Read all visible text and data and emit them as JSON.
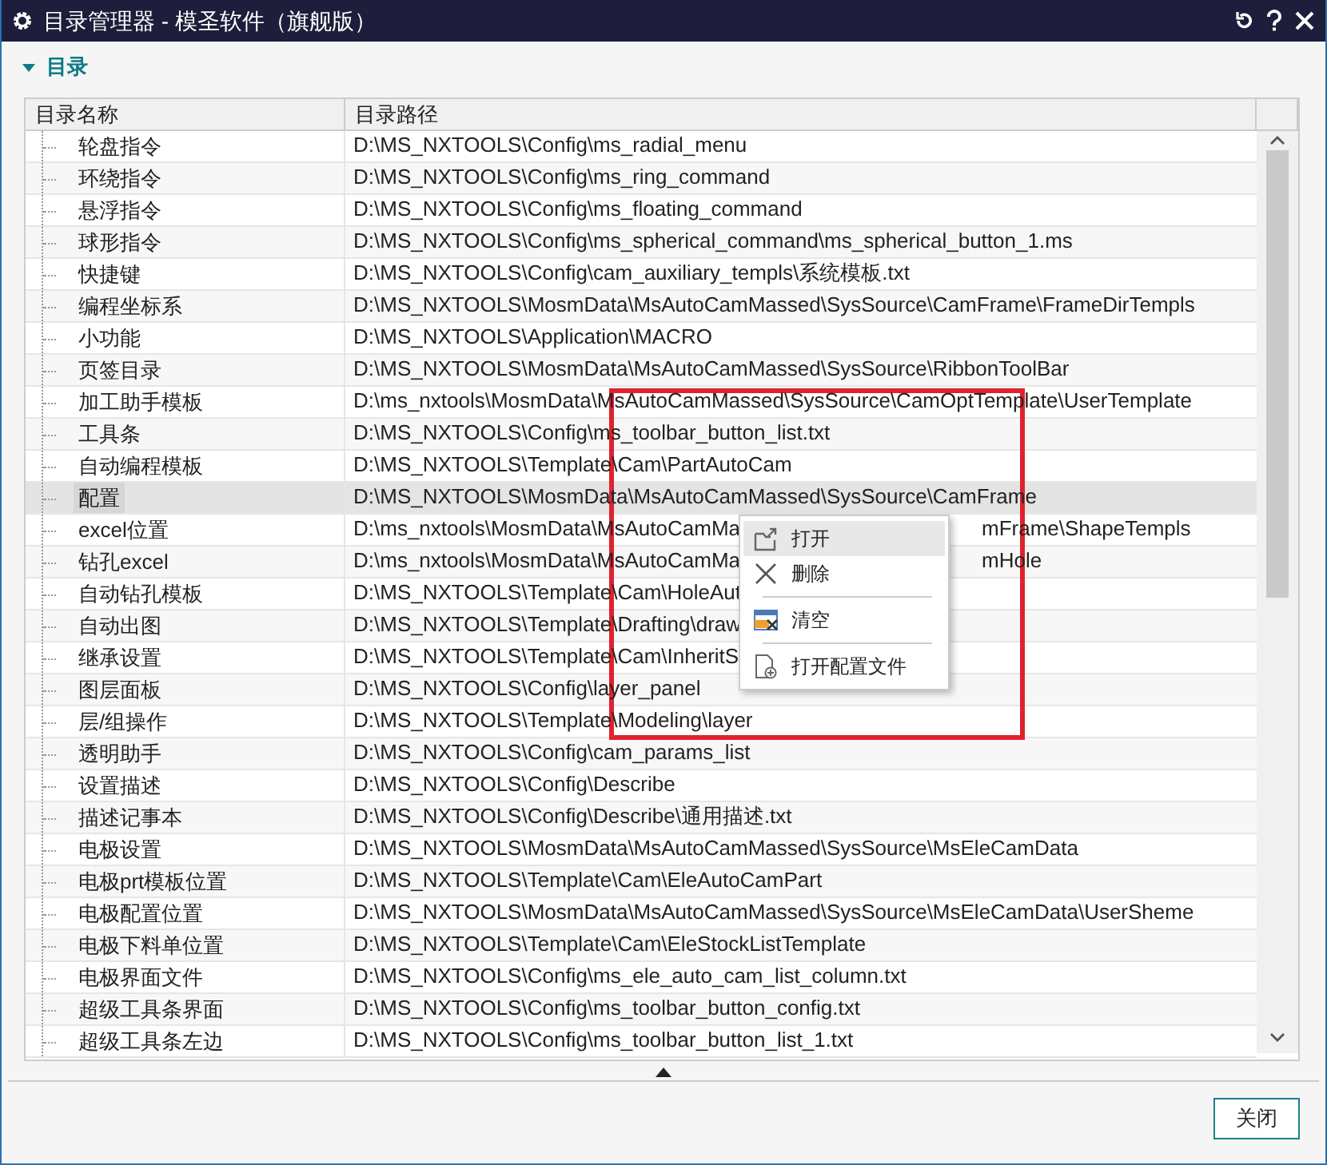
{
  "window": {
    "title": "目录管理器 - 模圣软件（旗舰版）"
  },
  "section": {
    "label": "目录",
    "expanded": true
  },
  "table": {
    "columns": [
      "目录名称",
      "目录路径"
    ],
    "rows": [
      {
        "name": "轮盘指令",
        "path": "D:\\MS_NXTOOLS\\Config\\ms_radial_menu",
        "selected": false
      },
      {
        "name": "环绕指令",
        "path": "D:\\MS_NXTOOLS\\Config\\ms_ring_command",
        "selected": false
      },
      {
        "name": "悬浮指令",
        "path": "D:\\MS_NXTOOLS\\Config\\ms_floating_command",
        "selected": false
      },
      {
        "name": "球形指令",
        "path": "D:\\MS_NXTOOLS\\Config\\ms_spherical_command\\ms_spherical_button_1.ms",
        "selected": false
      },
      {
        "name": "快捷键",
        "path": "D:\\MS_NXTOOLS\\Config\\cam_auxiliary_templs\\系统模板.txt",
        "selected": false
      },
      {
        "name": "编程坐标系",
        "path": "D:\\MS_NXTOOLS\\MosmData\\MsAutoCamMassed\\SysSource\\CamFrame\\FrameDirTempls",
        "selected": false
      },
      {
        "name": "小功能",
        "path": "D:\\MS_NXTOOLS\\Application\\MACRO",
        "selected": false
      },
      {
        "name": "页签目录",
        "path": "D:\\MS_NXTOOLS\\MosmData\\MsAutoCamMassed\\SysSource\\RibbonToolBar",
        "selected": false
      },
      {
        "name": "加工助手模板",
        "path": "D:\\ms_nxtools\\MosmData\\MsAutoCamMassed\\SysSource\\CamOptTemplate\\UserTemplate",
        "selected": false
      },
      {
        "name": "工具条",
        "path": "D:\\MS_NXTOOLS\\Config\\ms_toolbar_button_list.txt",
        "selected": false
      },
      {
        "name": "自动编程模板",
        "path": "D:\\MS_NXTOOLS\\Template\\Cam\\PartAutoCam",
        "selected": false
      },
      {
        "name": "配置",
        "path": "D:\\MS_NXTOOLS\\MosmData\\MsAutoCamMassed\\SysSource\\CamFrame",
        "selected": true
      },
      {
        "name": "excel位置",
        "path": "D:\\ms_nxtools\\MosmData\\MsAutoCamMa",
        "path_tail": "mFrame\\ShapeTempls",
        "selected": false
      },
      {
        "name": "钻孔excel",
        "path": "D:\\ms_nxtools\\MosmData\\MsAutoCamMa",
        "path_tail": "mHole",
        "selected": false
      },
      {
        "name": "自动钻孔模板",
        "path": "D:\\MS_NXTOOLS\\Template\\Cam\\HoleAut",
        "selected": false
      },
      {
        "name": "自动出图",
        "path": "D:\\MS_NXTOOLS\\Template\\Drafting\\draw",
        "selected": false
      },
      {
        "name": "继承设置",
        "path": "D:\\MS_NXTOOLS\\Template\\Cam\\InheritS",
        "selected": false
      },
      {
        "name": "图层面板",
        "path": "D:\\MS_NXTOOLS\\Config\\layer_panel",
        "selected": false
      },
      {
        "name": "层/组操作",
        "path": "D:\\MS_NXTOOLS\\Template\\Modeling\\layer",
        "selected": false
      },
      {
        "name": "透明助手",
        "path": "D:\\MS_NXTOOLS\\Config\\cam_params_list",
        "selected": false
      },
      {
        "name": "设置描述",
        "path": "D:\\MS_NXTOOLS\\Config\\Describe",
        "selected": false
      },
      {
        "name": "描述记事本",
        "path": "D:\\MS_NXTOOLS\\Config\\Describe\\通用描述.txt",
        "selected": false
      },
      {
        "name": "电极设置",
        "path": "D:\\MS_NXTOOLS\\MosmData\\MsAutoCamMassed\\SysSource\\MsEleCamData",
        "selected": false
      },
      {
        "name": "电极prt模板位置",
        "path": "D:\\MS_NXTOOLS\\Template\\Cam\\EleAutoCamPart",
        "selected": false
      },
      {
        "name": "电极配置位置",
        "path": "D:\\MS_NXTOOLS\\MosmData\\MsAutoCamMassed\\SysSource\\MsEleCamData\\UserSheme",
        "selected": false
      },
      {
        "name": "电极下料单位置",
        "path": "D:\\MS_NXTOOLS\\Template\\Cam\\EleStockListTemplate",
        "selected": false
      },
      {
        "name": "电极界面文件",
        "path": "D:\\MS_NXTOOLS\\Config\\ms_ele_auto_cam_list_column.txt",
        "selected": false
      },
      {
        "name": "超级工具条界面",
        "path": "D:\\MS_NXTOOLS\\Config\\ms_toolbar_button_config.txt",
        "selected": false
      },
      {
        "name": "超级工具条左边",
        "path": "D:\\MS_NXTOOLS\\Config\\ms_toolbar_button_list_1.txt",
        "selected": false
      }
    ]
  },
  "context_menu": {
    "items": [
      {
        "kind": "open",
        "label": "打开",
        "highlighted": true
      },
      {
        "kind": "delete",
        "label": "删除",
        "highlighted": false
      },
      {
        "kind": "separator"
      },
      {
        "kind": "clear",
        "label": "清空",
        "highlighted": false
      },
      {
        "kind": "separator"
      },
      {
        "kind": "file",
        "label": "打开配置文件",
        "highlighted": false
      }
    ]
  },
  "buttons": [
    "关闭"
  ]
}
